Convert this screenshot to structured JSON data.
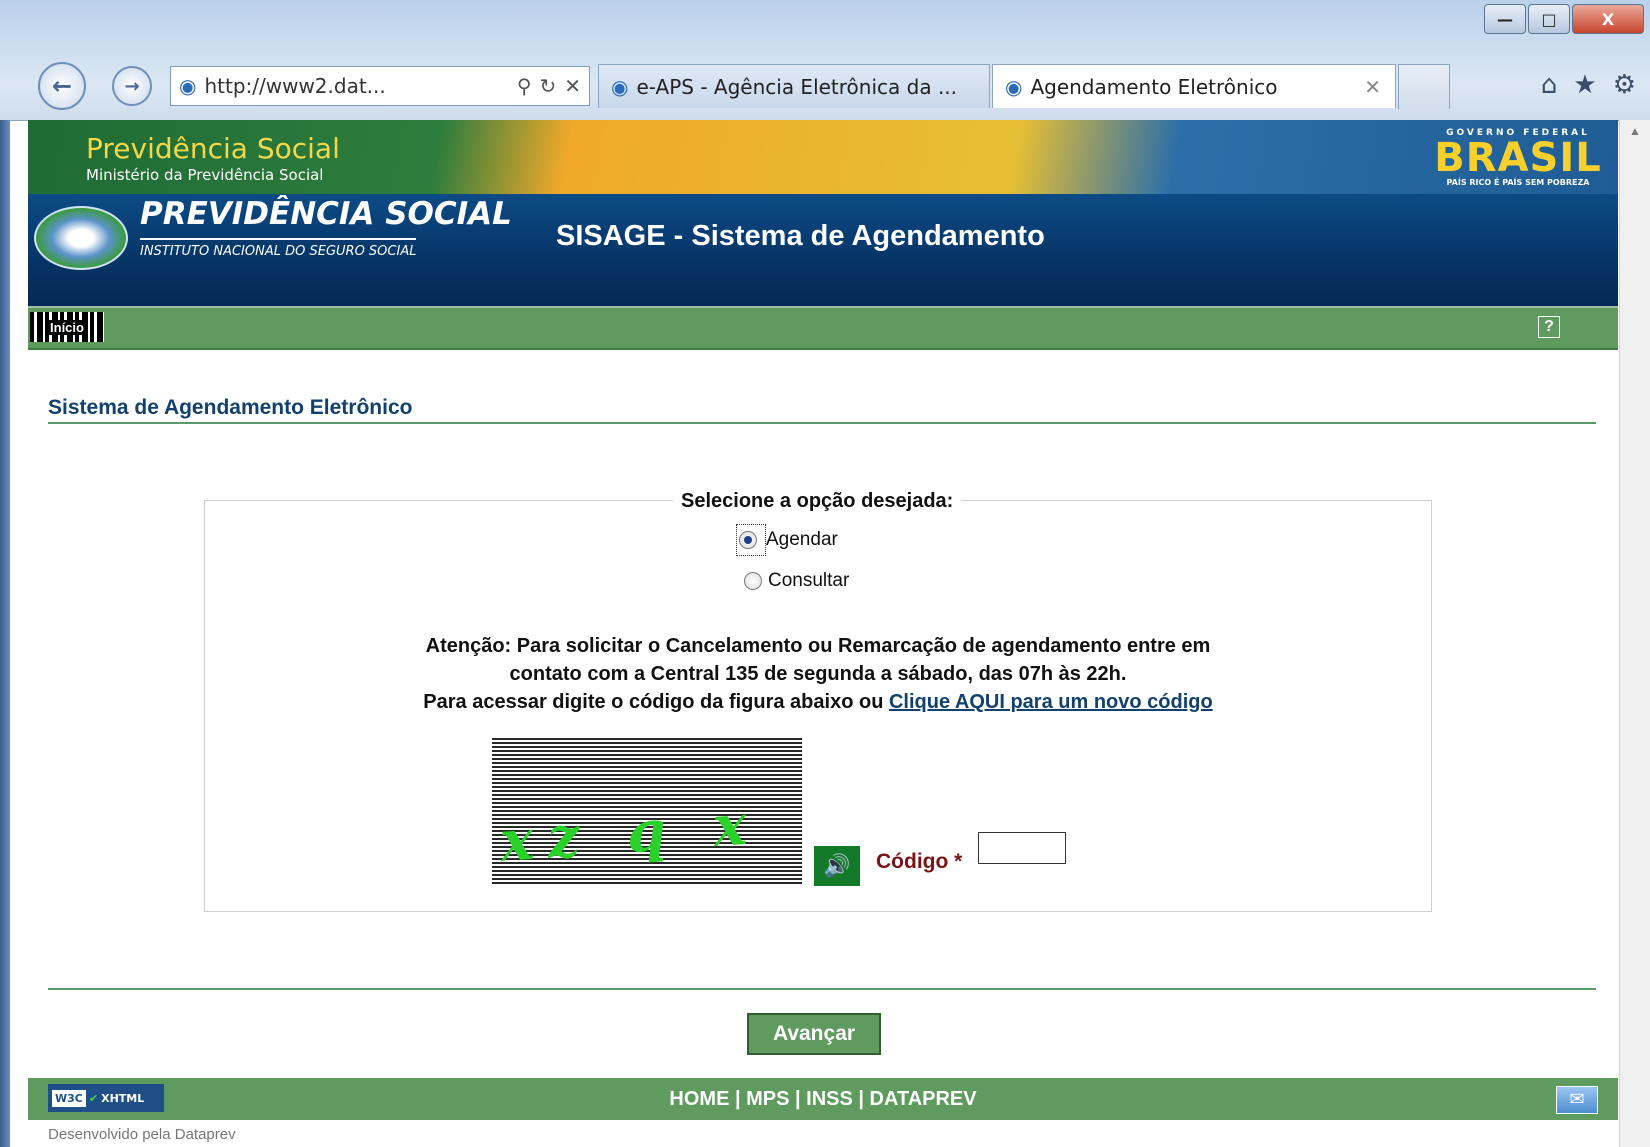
{
  "browser": {
    "address": "http://www2.dat...",
    "tabs": [
      {
        "label": "e-APS - Agência Eletrônica da ..."
      },
      {
        "label": "Agendamento Eletrônico"
      }
    ]
  },
  "header": {
    "ps_title": "Previdência Social",
    "ps_subtitle": "Ministério da Previdência Social",
    "inst_title": "PREVIDÊNCIA SOCIAL",
    "inst_subtitle": "INSTITUTO NACIONAL DO SEGURO SOCIAL",
    "system_title": "SISAGE - Sistema de Agendamento",
    "gov_tag": "GOVERNO FEDERAL",
    "gov_brasil": "BRASIL",
    "gov_slogan": "PAÍS RICO É PAÍS SEM POBREZA"
  },
  "menu": {
    "home": "Início",
    "help": "?"
  },
  "main": {
    "section_title": "Sistema de Agendamento Eletrônico",
    "legend": "Selecione a opção desejada:",
    "options": [
      {
        "label": "Agendar",
        "checked": true
      },
      {
        "label": "Consultar",
        "checked": false
      }
    ],
    "attention_line1": "Atenção: Para solicitar o Cancelamento ou Remarcação de agendamento entre em",
    "attention_line2": "contato com a Central 135 de segunda a sábado, das 07h às 22h.",
    "access_text": "Para acessar digite o código da figura abaixo ou ",
    "new_code_link": "Clique AQUI para um novo código",
    "captcha_text": "xz q x",
    "codigo_label": "Código *",
    "codigo_value": "",
    "submit_label": "Avançar"
  },
  "footer": {
    "badge": "XHTML",
    "badge_w3c": "W3C",
    "links": "HOME | MPS | INSS | DATAPREV",
    "developer": "Desenvolvido pela Dataprev"
  }
}
